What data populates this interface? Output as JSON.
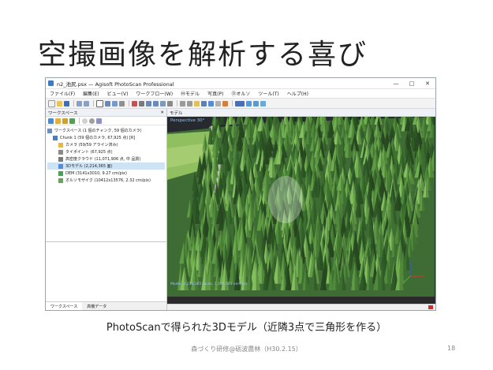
{
  "slide": {
    "title": "空撮画像を解析する喜び",
    "caption": "PhotoScanで得られた3Dモデル（近隣3点で三角形を作る）",
    "footer": "森づくり研修@砺波農林（H30.2.15）",
    "page_number": "18"
  },
  "window": {
    "title": "n2_池尻.psx — Agisoft PhotoScan Professional",
    "controls": [
      "—",
      "□",
      "✕"
    ],
    "menu": [
      "ファイル(F)",
      "編集(E)",
      "ビュー(V)",
      "ワークフロー(W)",
      "Ⓜモデル",
      "写真(P)",
      "Ⓞオルソ",
      "ツール(T)",
      "ヘルプ(H)"
    ]
  },
  "workspace": {
    "panel_title": "ワークスペース",
    "close_glyph": "✕",
    "tree": [
      {
        "label": "ワークスペース (1 個のチャンク, 59 個のカメラ)",
        "indent": 0,
        "icon": "workspace-icon",
        "color": "#6b8fbf",
        "selected": false
      },
      {
        "label": "Chunk 1 (59 個のカメラ, 67,925 点) [R]",
        "indent": 1,
        "icon": "chunk-icon",
        "color": "#4a7cc0",
        "selected": false
      },
      {
        "label": "カメラ (59/59 アライン済み)",
        "indent": 2,
        "icon": "folder-icon",
        "color": "#e5b84a",
        "selected": false
      },
      {
        "label": "タイポイント (67,925 点)",
        "indent": 2,
        "icon": "tie-points-icon",
        "color": "#8a8a8a",
        "selected": false
      },
      {
        "label": "高密度クラウド (11,071,906 点, 中 品質)",
        "indent": 2,
        "icon": "dense-cloud-icon",
        "color": "#7a7a7a",
        "selected": false
      },
      {
        "label": "3Dモデル (2,214,365 面)",
        "indent": 2,
        "icon": "model-icon",
        "color": "#5a8ad0",
        "selected": true
      },
      {
        "label": "DEM (3141x3010, 9.27 cm/pix)",
        "indent": 2,
        "icon": "dem-icon",
        "color": "#4aa05a",
        "selected": false
      },
      {
        "label": "オルソモザイク (10412x13576, 2.32 cm/pix)",
        "indent": 2,
        "icon": "ortho-icon",
        "color": "#6aa060",
        "selected": false
      }
    ],
    "bottom_tabs": [
      "ワークスペース",
      "高機データ"
    ]
  },
  "model_view": {
    "panel_title": "モデル",
    "projection_label": "Perspective 30°",
    "stat_label": "Model: 2,214,365 faces, 1,107,563 vertices"
  },
  "colors": {
    "selection": "#cde4f7",
    "forest_light": "#6aa84a",
    "forest_dark": "#1f3f1a"
  }
}
